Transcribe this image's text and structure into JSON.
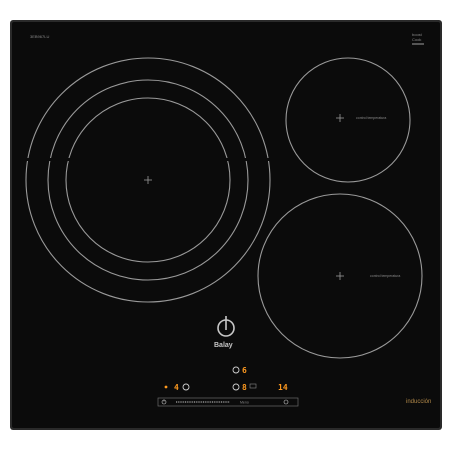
{
  "model_code": "3EB967LU",
  "top_right_logo": [
    "boost",
    "Cook"
  ],
  "zones": {
    "front_left_label": "",
    "rear_right_label": "control temperatura",
    "front_right_label": "control temperatura"
  },
  "brand": "Balay",
  "displays": {
    "top_digit": "6",
    "left_digit": "4",
    "mid_digit": "8",
    "timer": "14"
  },
  "control_bar_label": "Menú",
  "technology_label": "inducción",
  "colors": {
    "glass": "#0b0b0b",
    "frame": "#2a2a2a",
    "zone_lines": "#9a9a9a",
    "display": "#ff9a1f",
    "technology_text": "#b38a4a"
  },
  "icons": [
    "left-zone-crosshair",
    "rear-right-crosshair",
    "front-right-crosshair",
    "balay-logo",
    "power-icon",
    "lock-icon"
  ]
}
